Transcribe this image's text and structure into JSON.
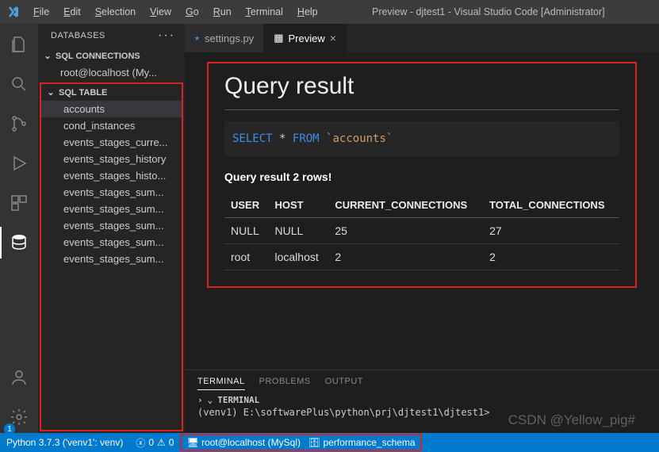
{
  "title": "Preview - djtest1 - Visual Studio Code [Administrator]",
  "menu": [
    "File",
    "Edit",
    "Selection",
    "View",
    "Go",
    "Run",
    "Terminal",
    "Help"
  ],
  "sidebar": {
    "header": "DATABASES",
    "sec1": "SQL CONNECTIONS",
    "conn": "root@localhost (My...",
    "sec2": "SQL TABLE",
    "tables": [
      "accounts",
      "cond_instances",
      "events_stages_curre...",
      "events_stages_history",
      "events_stages_histo...",
      "events_stages_sum...",
      "events_stages_sum...",
      "events_stages_sum...",
      "events_stages_sum...",
      "events_stages_sum..."
    ]
  },
  "tabs": {
    "t0": {
      "icon": "py",
      "label": "settings.py"
    },
    "t1": {
      "icon": "preview",
      "label": "Preview",
      "close": "×"
    }
  },
  "preview": {
    "heading": "Query result",
    "sql": {
      "kw1": "SELECT",
      "star": "*",
      "kw2": "FROM",
      "tbl": "`accounts`"
    },
    "rowinfo": "Query result 2 rows!"
  },
  "chart_data": {
    "type": "table",
    "columns": [
      "USER",
      "HOST",
      "CURRENT_CONNECTIONS",
      "TOTAL_CONNECTIONS"
    ],
    "rows": [
      [
        "NULL",
        "NULL",
        "25",
        "27"
      ],
      [
        "root",
        "localhost",
        "2",
        "2"
      ]
    ]
  },
  "panel": {
    "tabs": [
      "TERMINAL",
      "PROBLEMS",
      "OUTPUT"
    ],
    "title": "TERMINAL",
    "line": "(venv1) E:\\softwarePlus\\python\\prj\\djtest1\\djtest1>"
  },
  "status": {
    "python": "Python 3.7.3  ('venv1': venv)",
    "errors": "0",
    "warnings": "0",
    "conn": "root@localhost (MySql)",
    "db": "performance_schema"
  },
  "watermark": "CSDN @Yellow_pig#",
  "badge": "1"
}
